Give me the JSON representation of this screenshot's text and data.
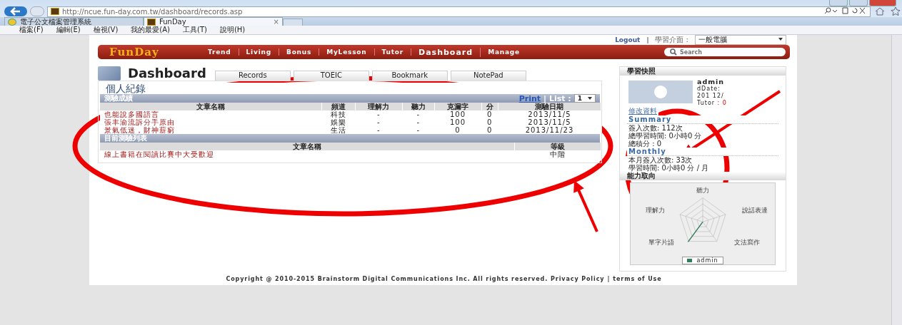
{
  "browser": {
    "url": "http://ncue.fun-day.com.tw/dashboard/records.asp",
    "tabs": [
      {
        "label": "電子公文檔案管理系統",
        "selected": false
      },
      {
        "label": "FunDay",
        "selected": true
      }
    ],
    "close_tab": "×",
    "menu": [
      "檔案(F)",
      "編輯(E)",
      "檢視(V)",
      "我的最愛(A)",
      "工具(T)",
      "說明(H)"
    ]
  },
  "topbar": {
    "logout": "Logout",
    "separator": "|",
    "interface_label": "學習介面 :",
    "interface_value": "一般電腦"
  },
  "nav": {
    "logo": "FunDay",
    "items": [
      {
        "label": "Trend",
        "selected": false
      },
      {
        "label": "Living",
        "selected": false
      },
      {
        "label": "Bonus",
        "selected": false
      },
      {
        "label": "MyLesson",
        "selected": false
      },
      {
        "label": "Tutor",
        "selected": false
      },
      {
        "label": "Dashboard",
        "selected": true
      },
      {
        "label": "Manage",
        "selected": false
      }
    ],
    "search_placeholder": "Search"
  },
  "dashboard": {
    "title": "Dashboard",
    "tabs": [
      {
        "label": "Records"
      },
      {
        "label": "TOEIC"
      },
      {
        "label": "Bookmark"
      },
      {
        "label": "NotePad"
      }
    ]
  },
  "records": {
    "heading": "個人紀錄",
    "scores": {
      "title": "測驗成績",
      "print": "Print",
      "list_label": "| List :",
      "list_value": "1",
      "columns": [
        "文章名稱",
        "頻道",
        "理解力",
        "聽力",
        "克漏字",
        "分",
        "測驗日期"
      ],
      "rows": [
        [
          "也能說多國語言",
          "科技",
          "-",
          "-",
          "100",
          "0",
          "2013/11/5"
        ],
        [
          "張丰渝流訴分手原由",
          "娛樂",
          "-",
          "-",
          "100",
          "0",
          "2013/11/5"
        ],
        [
          "景氣低迷，財神薪窮",
          "生活",
          "-",
          "-",
          "0",
          "0",
          "2013/11/23"
        ]
      ]
    },
    "current": {
      "title": "目前測驗列表",
      "columns": [
        "文章名稱",
        "等級"
      ],
      "rows": [
        [
          "線上書籍在閱讀比賽中大受歡迎",
          "中階"
        ]
      ]
    }
  },
  "snapshot": {
    "title": "學習快照",
    "user": "admin",
    "info": [
      "dDate:",
      "201  12/",
      "Tutor"
    ],
    "tutor_value": ": 0",
    "edit": "修改資料",
    "summary_title": "Summary",
    "summary": [
      "簽入次數: 112次",
      "總學習時間: 0小時0 分",
      "總積分 : 0"
    ],
    "monthly_title": "Monthly",
    "monthly": [
      "本月簽入次數: 33次",
      "學習時間: 0小時0 分 / 月"
    ],
    "ability_title": "能力取向",
    "axes": [
      "聽力",
      "說話表達",
      "文法寫作",
      "單字片語",
      "理解力"
    ],
    "legend": "admin"
  },
  "footer": {
    "copyright": "Copyright @ 2010-2015 Brainstorm Digital Communications Inc. All rights reserved.",
    "privacy": "Privacy Policy",
    "separator": "|",
    "terms": "terms of Use"
  },
  "annotations": [
    {
      "kind": "ellipse"
    },
    {
      "kind": "ellipse"
    },
    {
      "kind": "arrow"
    },
    {
      "kind": "arrow"
    }
  ]
}
